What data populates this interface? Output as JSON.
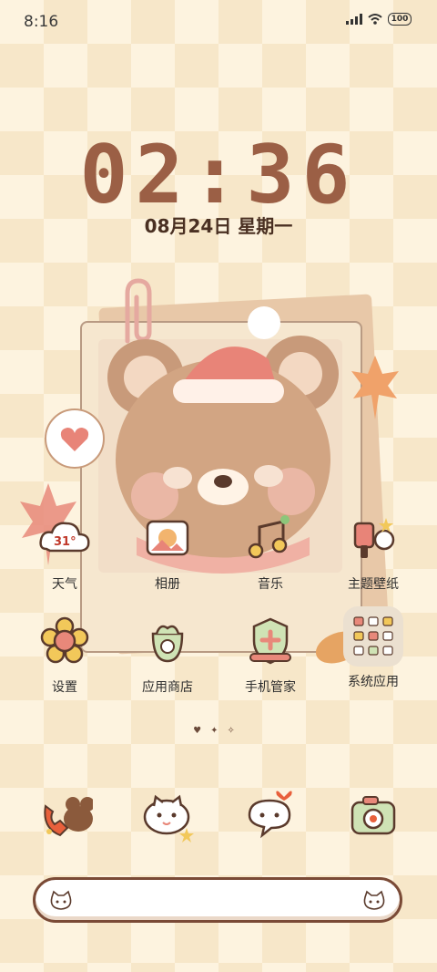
{
  "status_bar": {
    "time": "8:16",
    "battery": "100"
  },
  "clock": {
    "time": "02:36",
    "date": "08月24日 星期一"
  },
  "apps": [
    {
      "label": "天气",
      "icon": "weather-cloud-icon",
      "badge": "31°"
    },
    {
      "label": "相册",
      "icon": "photo-album-icon"
    },
    {
      "label": "音乐",
      "icon": "music-note-icon"
    },
    {
      "label": "主题壁纸",
      "icon": "theme-paint-icon"
    },
    {
      "label": "设置",
      "icon": "settings-flower-icon"
    },
    {
      "label": "应用商店",
      "icon": "app-store-bag-icon"
    },
    {
      "label": "手机管家",
      "icon": "phone-manager-shield-icon"
    },
    {
      "label": "系统应用",
      "icon": "system-apps-folder-icon"
    }
  ],
  "dock": [
    {
      "icon": "phone-bear-icon"
    },
    {
      "icon": "messages-cat-icon"
    },
    {
      "icon": "chat-bubble-icon"
    },
    {
      "icon": "camera-icon"
    }
  ],
  "page_indicator": [
    "♥",
    "✦",
    "✧"
  ],
  "colors": {
    "clock": "#9b5f45",
    "background": "#fdf3df",
    "checker": "#f7e7c9",
    "search_border": "#7a4a36"
  }
}
